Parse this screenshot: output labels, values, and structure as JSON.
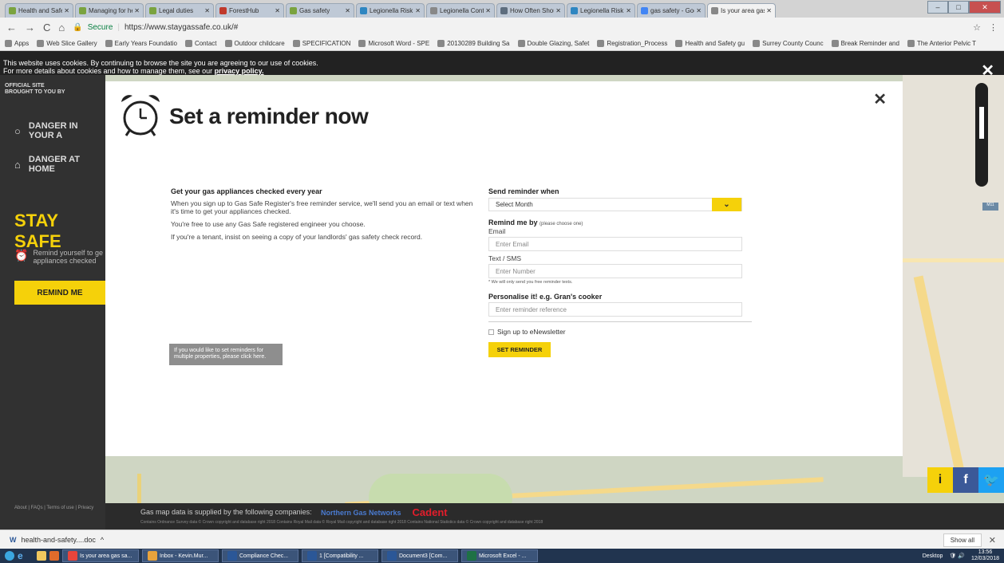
{
  "browser": {
    "tabs": [
      {
        "label": "Health and Safet",
        "color": "#7aa33f"
      },
      {
        "label": "Managing for he",
        "color": "#7aa33f"
      },
      {
        "label": "Legal duties",
        "color": "#7aa33f"
      },
      {
        "label": "ForestHub",
        "color": "#c0392b"
      },
      {
        "label": "Gas safety",
        "color": "#7aa33f"
      },
      {
        "label": "Legionella Risk A",
        "color": "#2e86c1"
      },
      {
        "label": "Legionella Contr",
        "color": "#888888"
      },
      {
        "label": "How Often Shou",
        "color": "#5d6d7e"
      },
      {
        "label": "Legionella Risk A",
        "color": "#2e86c1"
      },
      {
        "label": "gas safety - Goo",
        "color": "#4285f4"
      },
      {
        "label": "Is your area gas",
        "color": "#888888"
      }
    ],
    "url_secure": "Secure",
    "url": "https://www.staygassafe.co.uk/#",
    "bookmarks": [
      "Apps",
      "Web Slice Gallery",
      "Early Years Foundatio",
      "Contact",
      "Outdoor childcare",
      "SPECIFICATION",
      "Microsoft Word - SPE",
      "20130289 Building Sa",
      "Double Glazing, Safet",
      "Registration_Process",
      "Health and Safety gu",
      "Surrey County Counc",
      "Break Reminder and",
      "The Anterior Pelvic T"
    ]
  },
  "cookie": {
    "line1": "This website uses cookies. By continuing to browse the site you are agreeing to our use of cookies.",
    "line2": "For more details about cookies and how to manage them, see our ",
    "link": "privacy policy."
  },
  "sidebar": {
    "official": "OFFICIAL SITE",
    "brought": "BROUGHT TO YOU BY",
    "item1": "DANGER IN YOUR A",
    "item2": "DANGER AT HOME",
    "stay": "STAY SAFE",
    "remind_text": "Remind yourself to ge appliances checked",
    "remind_btn": "REMIND ME",
    "footer": "About | FAQs | Terms of use | Privacy"
  },
  "map": {
    "bottom_text": "Gas map data is supplied by the following companies:",
    "bottom_small": "Contains Ordnance Survey data © Crown copyright and database right 2018 Contains Royal Mail data © Royal Mail copyright and database right 2018 Contains National Statistics data © Crown copyright and database right 2018",
    "logos": [
      "Northern Gas Networks",
      "Cadent"
    ],
    "info_btn": "i",
    "fb_btn": "f"
  },
  "modal": {
    "title": "Set a reminder now",
    "info_heading": "Get your gas appliances checked every year",
    "info_p1": "When you sign up to Gas Safe Register's free reminder service, we'll send you an email or text when it's time to get your appliances checked.",
    "info_p2": "You're free to use any Gas Safe registered engineer you choose.",
    "info_p3": "If you're a tenant, insist on seeing a copy of your landlords' gas safety check record.",
    "multi": "If you would like to set reminders for multiple properties, please click here.",
    "send_when": "Send reminder when",
    "select_month": "Select Month",
    "remind_by": "Remind me by",
    "remind_by_note": "(please choose one)",
    "email_label": "Email",
    "email_placeholder": "Enter Email",
    "sms_label": "Text / SMS",
    "sms_placeholder": "Enter Number",
    "sms_note": "* We will only send you free reminder texts.",
    "personalise": "Personalise it! e.g. Gran's cooker",
    "ref_placeholder": "Enter reminder reference",
    "newsletter": "Sign up to eNewsletter",
    "submit": "SET REMINDER"
  },
  "downloads": {
    "file": "health-and-safety....doc",
    "show_all": "Show all"
  },
  "taskbar": {
    "items": [
      {
        "label": "Is your area gas sa...",
        "color": "#e8453c"
      },
      {
        "label": "Inbox - Kevin.Mur...",
        "color": "#e8a33c"
      },
      {
        "label": "Compliance Chec...",
        "color": "#2b5797"
      },
      {
        "label": "1 [Compatibility ...",
        "color": "#2b5797"
      },
      {
        "label": "Document3 [Com...",
        "color": "#2b5797"
      },
      {
        "label": "Microsoft Excel - ...",
        "color": "#1e7145"
      }
    ],
    "desktop": "Desktop",
    "time": "13:56",
    "date": "12/03/2018"
  },
  "colors": {
    "brand_yellow": "#f5d10a",
    "dark": "#2f2f2f"
  }
}
